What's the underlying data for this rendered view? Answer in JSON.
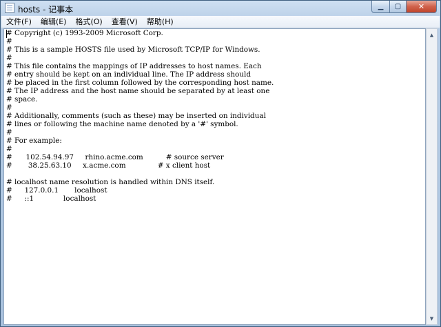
{
  "window": {
    "title": "hosts - 记事本",
    "icon": "notepad-icon",
    "controls": {
      "minimize": "▁",
      "maximize": "▢",
      "close": "✕"
    }
  },
  "menu": {
    "items": [
      {
        "label": "文件(F)"
      },
      {
        "label": "编辑(E)"
      },
      {
        "label": "格式(O)"
      },
      {
        "label": "查看(V)"
      },
      {
        "label": "帮助(H)"
      }
    ]
  },
  "editor": {
    "content": "# Copyright (c) 1993-2009 Microsoft Corp.\n#\n# This is a sample HOSTS file used by Microsoft TCP/IP for Windows.\n#\n# This file contains the mappings of IP addresses to host names. Each\n# entry should be kept on an individual line. The IP address should\n# be placed in the first column followed by the corresponding host name.\n# The IP address and the host name should be separated by at least one\n# space.\n#\n# Additionally, comments (such as these) may be inserted on individual\n# lines or following the machine name denoted by a '#' symbol.\n#\n# For example:\n#\n#      102.54.94.97     rhino.acme.com          # source server\n#       38.25.63.10     x.acme.com              # x client host\n\n# localhost name resolution is handled within DNS itself.\n#\t127.0.0.1       localhost\n#\t::1             localhost"
  },
  "scrollbar": {
    "up_arrow": "▲",
    "down_arrow": "▼"
  }
}
